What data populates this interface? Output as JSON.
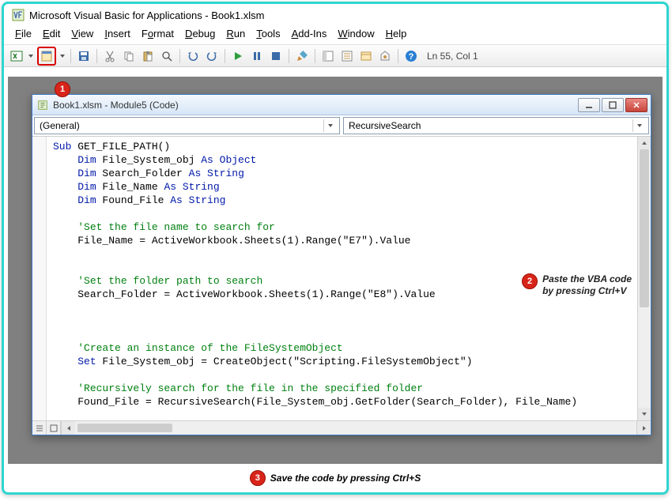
{
  "window": {
    "title": "Microsoft Visual Basic for Applications - Book1.xlsm"
  },
  "menu": {
    "file": "File",
    "edit": "Edit",
    "view": "View",
    "insert": "Insert",
    "format": "Format",
    "debug": "Debug",
    "run": "Run",
    "tools": "Tools",
    "addins": "Add-Ins",
    "window": "Window",
    "help": "Help"
  },
  "toolbar": {
    "status": "Ln 55, Col 1"
  },
  "code_window": {
    "title": "Book1.xlsm - Module5 (Code)",
    "dropdown_left": "(General)",
    "dropdown_right": "RecursiveSearch"
  },
  "code": {
    "l1a": "Sub",
    "l1b": " GET_FILE_PATH()",
    "l2a": "Dim",
    "l2b": " File_System_obj ",
    "l2c": "As Object",
    "l3a": "Dim",
    "l3b": " Search_Folder ",
    "l3c": "As String",
    "l4a": "Dim",
    "l4b": " File_Name ",
    "l4c": "As String",
    "l5a": "Dim",
    "l5b": " Found_File ",
    "l5c": "As String",
    "l6": "'Set the file name to search for",
    "l7": "File_Name = ActiveWorkbook.Sheets(1).Range(\"E7\").Value",
    "l8": "'Set the folder path to search",
    "l9": "Search_Folder = ActiveWorkbook.Sheets(1).Range(\"E8\").Value",
    "l10": "'Create an instance of the FileSystemObject",
    "l11a": "Set",
    "l11b": " File_System_obj = CreateObject(\"Scripting.FileSystemObject\")",
    "l12": "'Recursively search for the file in the specified folder",
    "l13": "Found_File = RecursiveSearch(File_System_obj.GetFolder(Search_Folder), File_Name)"
  },
  "annotations": {
    "b1": "1",
    "b2": "2",
    "b2_text1": "Paste the VBA code",
    "b2_text2": "by pressing Ctrl+V",
    "b3": "3",
    "b3_text": "Save the code by pressing Ctrl+S"
  }
}
